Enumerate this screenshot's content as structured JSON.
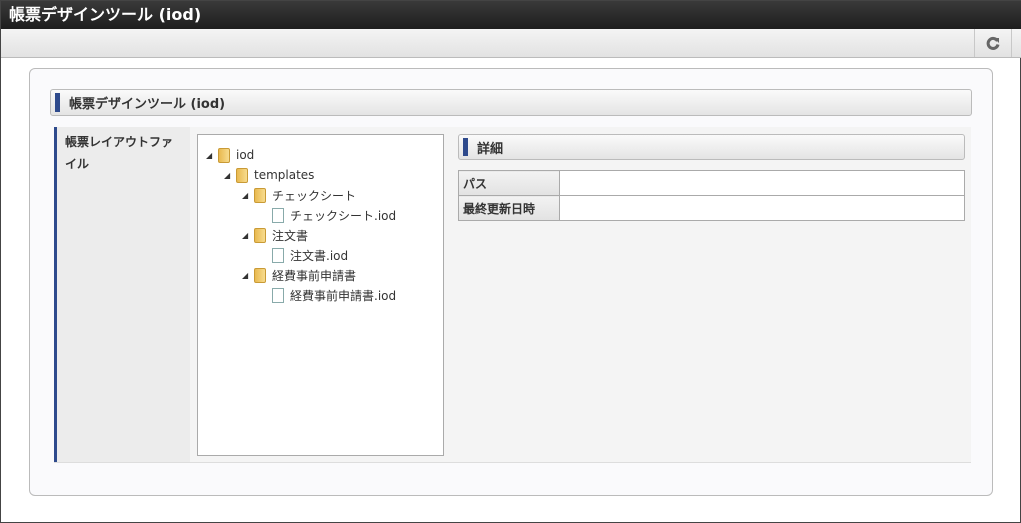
{
  "app": {
    "title": "帳票デザインツール (iod)"
  },
  "toolbar": {
    "refresh_icon": "refresh-icon"
  },
  "panel": {
    "title": "帳票デザインツール (iod)",
    "field_label": "帳票レイアウトファイル",
    "tree": [
      {
        "label": "iod",
        "type": "folder",
        "depth": 0
      },
      {
        "label": "templates",
        "type": "folder",
        "depth": 1
      },
      {
        "label": "チェックシート",
        "type": "folder",
        "depth": 2
      },
      {
        "label": "チェックシート.iod",
        "type": "file",
        "depth": 3
      },
      {
        "label": "注文書",
        "type": "folder",
        "depth": 2
      },
      {
        "label": "注文書.iod",
        "type": "file",
        "depth": 3
      },
      {
        "label": "経費事前申請書",
        "type": "folder",
        "depth": 2
      },
      {
        "label": "経費事前申請書.iod",
        "type": "file",
        "depth": 3
      }
    ],
    "detail": {
      "title": "詳細",
      "rows": [
        {
          "label": "パス",
          "value": ""
        },
        {
          "label": "最終更新日時",
          "value": ""
        }
      ]
    }
  },
  "colors": {
    "accent": "#2e4a8c"
  }
}
